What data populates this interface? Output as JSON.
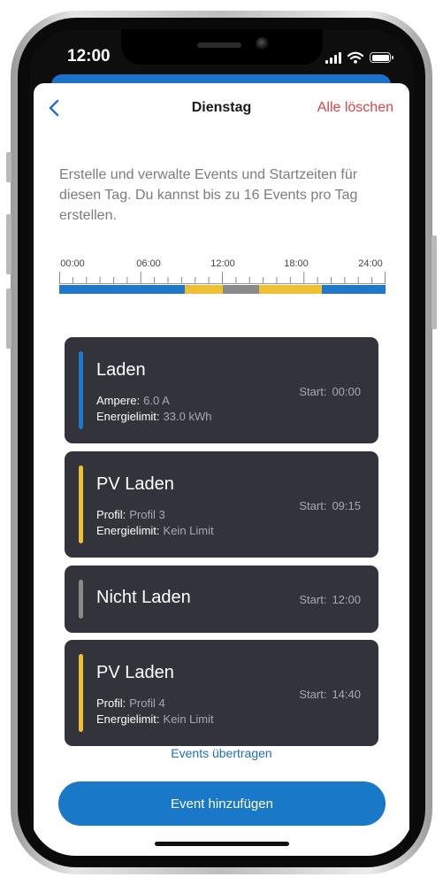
{
  "status_bar": {
    "time": "12:00"
  },
  "nav": {
    "title": "Dienstag",
    "clear_all": "Alle löschen"
  },
  "intro_text": "Erstelle und verwalte Events und Startzeiten für diesen Tag. Du kannst bis zu 16 Events pro Tag erstellen.",
  "timeline": {
    "labels": [
      "00:00",
      "06:00",
      "12:00",
      "18:00",
      "24:00"
    ],
    "segments": [
      {
        "type": "Laden",
        "start": "00:00",
        "end": "09:15",
        "color": "#1f78c8"
      },
      {
        "type": "PV Laden",
        "start": "09:15",
        "end": "12:00",
        "color": "#f0c034"
      },
      {
        "type": "Nicht Laden",
        "start": "12:00",
        "end": "14:40",
        "color": "#8a8a8a"
      },
      {
        "type": "PV Laden",
        "start": "14:40",
        "end": "19:20",
        "color": "#f0c034"
      },
      {
        "type": "Laden",
        "start": "19:20",
        "end": "24:00",
        "color": "#1f78c8"
      }
    ]
  },
  "events": [
    {
      "title": "Laden",
      "accent": "#1f78c8",
      "start_label": "Start:",
      "start": "00:00",
      "lines": [
        {
          "label": "Ampere:",
          "value": "6.0 A"
        },
        {
          "label": "Energielimit:",
          "value": "33.0 kWh"
        }
      ]
    },
    {
      "title": "PV Laden",
      "accent": "#f0c034",
      "start_label": "Start:",
      "start": "09:15",
      "lines": [
        {
          "label": "Profil:",
          "value": "Profil 3"
        },
        {
          "label": "Energielimit:",
          "value": "Kein Limit"
        }
      ]
    },
    {
      "title": "Nicht Laden",
      "accent": "#8a8a8a",
      "start_label": "Start:",
      "start": "12:00",
      "lines": []
    },
    {
      "title": "PV Laden",
      "accent": "#f0c034",
      "start_label": "Start:",
      "start": "14:40",
      "lines": [
        {
          "label": "Profil:",
          "value": "Profil 4"
        },
        {
          "label": "Energielimit:",
          "value": "Kein Limit"
        }
      ]
    }
  ],
  "transfer_link": "Events übertragen",
  "add_button": "Event hinzufügen",
  "colors": {
    "accent_blue": "#1a78c9",
    "danger_red": "#d64545",
    "card_bg": "#33333b"
  },
  "icons": {
    "back": "chevron-left-icon",
    "signal": "cellular-signal-icon",
    "wifi": "wifi-icon",
    "battery": "battery-icon"
  }
}
